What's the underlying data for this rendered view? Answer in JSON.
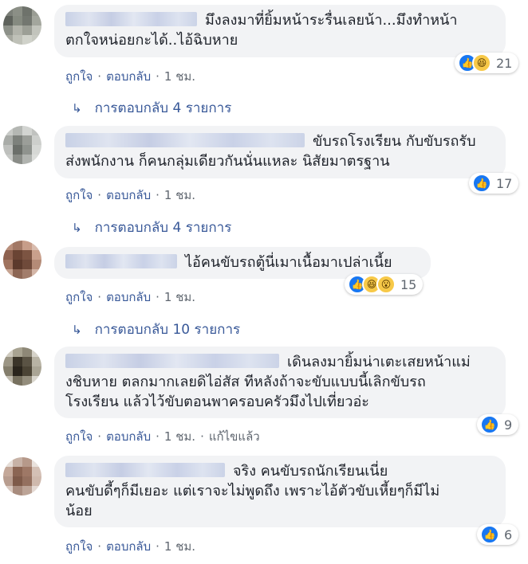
{
  "ui": {
    "like_label": "ถูกใจ",
    "reply_label": "ตอบกลับ",
    "separator": "·",
    "like_icon": "thumbs-up-icon",
    "haha_icon": "haha-face-icon",
    "wow_icon": "wow-face-icon",
    "colors": {
      "link": "#385898",
      "meta": "#606770",
      "bubble": "#f2f3f5",
      "like": "#1877f2"
    }
  },
  "comments": [
    {
      "text_line1": "มึงลงมาที่ยิ้มหน้าระรื่นเลยน้า...มึงทำหน้า",
      "text_line2": "ตกใจหน่อยกะได้..ไอ้ฉิบหาย",
      "reaction_count": "21",
      "time": "1 ชม.",
      "replies_label": "การตอบกลับ 4 รายการ"
    },
    {
      "text_line1": "ขับรถโรงเรียน กับขับรถรับ",
      "text_line2": "ส่งพนักงาน ก็คนกลุ่มเดียวกันนั่นแหละ นิสัยมาตรฐาน",
      "reaction_count": "17",
      "time": "1 ชม.",
      "replies_label": "การตอบกลับ 4 รายการ"
    },
    {
      "text_line1": "ไอ้คนขับรถตู้นี่เมาเนื้อมาเปล่าเนี้ย",
      "reaction_count": "15",
      "time": "1 ชม.",
      "replies_label": "การตอบกลับ 10 รายการ"
    },
    {
      "text_line1": "เดินลงมายิ้มน่าเตะเสยหน้าแม่",
      "text_line2": "งชิบหาย ตลกมากเลยดิไอ่สัส ทีหลังถ้าจะขับแบบนี้เลิกขับรถ",
      "text_line3": "โรงเรียน แล้วไว้ขับตอนพาครอบครัวมึงไปเที่ยวอ่ะ",
      "reaction_count": "9",
      "time": "1 ชม.",
      "edited": "แก้ไขแล้ว"
    },
    {
      "text_line1": "จริง คนขับรถนักเรียนเนี่ย",
      "text_line2": "คนขับดี้ๆก็มีเยอะ แต่เราจะไม่พูดถึง เพราะไอ้ตัวขับเหี้ยๆก็มีไม่",
      "text_line3": "น้อย",
      "reaction_count": "6",
      "time": "1 ชม."
    }
  ]
}
